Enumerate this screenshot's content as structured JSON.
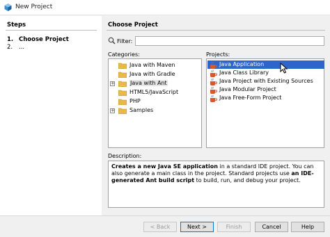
{
  "window": {
    "title": "New Project",
    "icon": "netbeans-icon"
  },
  "steps": {
    "heading": "Steps",
    "items": [
      {
        "num": "1.",
        "label": "Choose Project"
      },
      {
        "num": "2.",
        "label": "..."
      }
    ]
  },
  "main": {
    "heading": "Choose Project",
    "filter": {
      "label": "Filter:",
      "value": ""
    },
    "categories": {
      "label": "Categories:",
      "items": [
        {
          "label": "Java with Maven",
          "expander": ""
        },
        {
          "label": "Java with Gradle",
          "expander": ""
        },
        {
          "label": "Java with Ant",
          "expander": "+"
        },
        {
          "label": "HTML5/JavaScript",
          "expander": ""
        },
        {
          "label": "PHP",
          "expander": ""
        },
        {
          "label": "Samples",
          "expander": "+"
        }
      ],
      "selected": "Java with Ant"
    },
    "projects": {
      "label": "Projects:",
      "items": [
        {
          "label": "Java Application",
          "icon": "java-project-icon"
        },
        {
          "label": "Java Class Library",
          "icon": "java-project-icon"
        },
        {
          "label": "Java Project with Existing Sources",
          "icon": "java-project-icon"
        },
        {
          "label": "Java Modular Project",
          "icon": "java-project-icon"
        },
        {
          "label": "Java Free-Form Project",
          "icon": "java-project-icon"
        }
      ],
      "selected": "Java Application"
    },
    "description": {
      "label": "Description:",
      "bold1": "Creates a new Java SE application",
      "text1": " in a standard IDE project. You can also generate a main class in the project. Standard projects use ",
      "bold2": "an IDE-generated Ant build script",
      "text2": " to build, run, and debug your project."
    }
  },
  "footer": {
    "back": "< Back",
    "next": "Next >",
    "finish": "Finish",
    "cancel": "Cancel",
    "help": "Help"
  },
  "colors": {
    "selection": "#2f65ca",
    "folder": "#e8b94a"
  }
}
